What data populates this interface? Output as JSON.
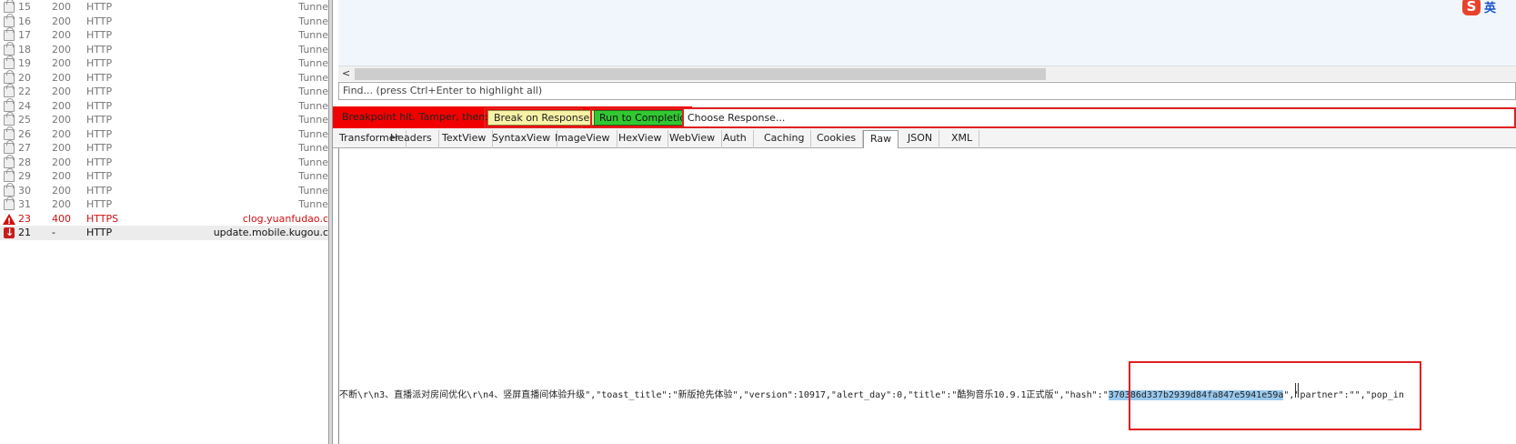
{
  "sessions": [
    {
      "num": "15",
      "result": "200",
      "protocol": "HTTP",
      "host": "Tunne",
      "kind": "tunnel"
    },
    {
      "num": "16",
      "result": "200",
      "protocol": "HTTP",
      "host": "Tunne",
      "kind": "tunnel"
    },
    {
      "num": "17",
      "result": "200",
      "protocol": "HTTP",
      "host": "Tunne",
      "kind": "tunnel"
    },
    {
      "num": "18",
      "result": "200",
      "protocol": "HTTP",
      "host": "Tunne",
      "kind": "tunnel"
    },
    {
      "num": "19",
      "result": "200",
      "protocol": "HTTP",
      "host": "Tunne",
      "kind": "tunnel"
    },
    {
      "num": "20",
      "result": "200",
      "protocol": "HTTP",
      "host": "Tunne",
      "kind": "tunnel"
    },
    {
      "num": "22",
      "result": "200",
      "protocol": "HTTP",
      "host": "Tunne",
      "kind": "tunnel"
    },
    {
      "num": "24",
      "result": "200",
      "protocol": "HTTP",
      "host": "Tunne",
      "kind": "tunnel"
    },
    {
      "num": "25",
      "result": "200",
      "protocol": "HTTP",
      "host": "Tunne",
      "kind": "tunnel"
    },
    {
      "num": "26",
      "result": "200",
      "protocol": "HTTP",
      "host": "Tunne",
      "kind": "tunnel"
    },
    {
      "num": "27",
      "result": "200",
      "protocol": "HTTP",
      "host": "Tunne",
      "kind": "tunnel"
    },
    {
      "num": "28",
      "result": "200",
      "protocol": "HTTP",
      "host": "Tunne",
      "kind": "tunnel"
    },
    {
      "num": "29",
      "result": "200",
      "protocol": "HTTP",
      "host": "Tunne",
      "kind": "tunnel"
    },
    {
      "num": "30",
      "result": "200",
      "protocol": "HTTP",
      "host": "Tunne",
      "kind": "tunnel"
    },
    {
      "num": "31",
      "result": "200",
      "protocol": "HTTP",
      "host": "Tunne",
      "kind": "tunnel"
    },
    {
      "num": "23",
      "result": "400",
      "protocol": "HTTPS",
      "host": "clog.yuanfudao.c",
      "kind": "error"
    },
    {
      "num": "21",
      "result": "-",
      "protocol": "HTTP",
      "host": "update.mobile.kugou.c",
      "kind": "breakpoint"
    }
  ],
  "find_placeholder": "Find... (press Ctrl+Enter to highlight all)",
  "ime": {
    "logo": "S",
    "mode": "英"
  },
  "breakpoint": {
    "message": "Breakpoint hit. Tamper, then:",
    "break_on_response": "Break on Response",
    "run_to_completion": "Run to Completion",
    "choose_response": "Choose Response..."
  },
  "tabs": [
    "Transformer",
    "Headers",
    "TextView",
    "SyntaxView",
    "ImageView",
    "HexView",
    "WebView",
    "Auth",
    "Caching",
    "Cookies",
    "Raw",
    "JSON",
    "XML"
  ],
  "active_tab": "Raw",
  "response": {
    "before": "不断\\r\\n3、直播派对房间优化\\r\\n4、竖屏直播间体验升级\",\"toast_title\":\"新版抢先体验\",\"version\":10917,\"alert_day\":0,\"title\":\"酷狗音乐10.9.1正式版\",\"hash\":\"",
    "highlighted": "370386d337b2939d84fa847e5941e59a",
    "after": "\",\"partner\":\"\",\"pop_in"
  },
  "colors": {
    "breakpoint_bar": "#f00000",
    "break_button": "#f7f2a6",
    "run_button": "#32c832",
    "annotation": "#e02020",
    "selection": "#99c9ef"
  }
}
